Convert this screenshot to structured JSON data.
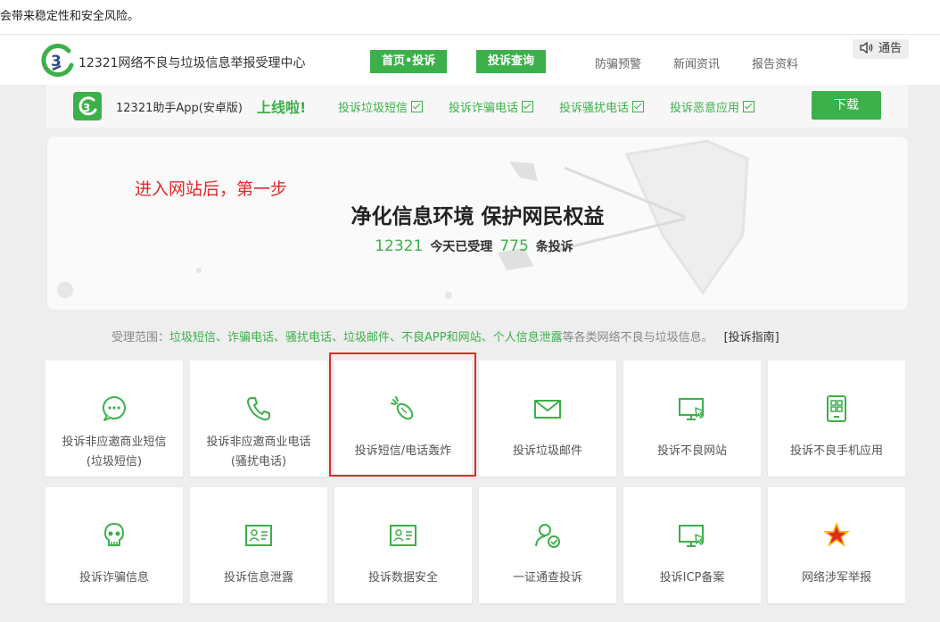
{
  "warning_text": "会带来稳定性和安全风险。",
  "header": {
    "site_title": "12321网络不良与垃圾信息举报受理中心",
    "nav_buttons": [
      "首页•投诉",
      "投诉查询"
    ],
    "nav_links": [
      "防骗预警",
      "新闻资讯",
      "报告资料"
    ],
    "notice": "通告",
    "notice_icon": "speaker-icon"
  },
  "app_bar": {
    "app_name": "12321助手App(安卓版)",
    "online": "上线啦!",
    "features": [
      "投诉垃圾短信",
      "投诉诈骗电话",
      "投诉骚扰电话",
      "投诉恶意应用"
    ],
    "download": "下载"
  },
  "hero": {
    "note": "进入网站后，第一步",
    "slogan": "净化信息环境 保护网民权益",
    "count_a": "12321",
    "text_a": "今天已受理",
    "count_b": "775",
    "text_b": "条投诉"
  },
  "scope": {
    "prefix": "受理范围：",
    "items": "垃圾短信、诈骗电话、骚扰电话、垃圾邮件、不良APP和网站、个人信息泄露",
    "suffix": "等各类网络不良与垃圾信息。",
    "guide": "[投诉指南]"
  },
  "colors": {
    "brand_green": "#3cb04a",
    "highlight_red": "#e02a2a"
  },
  "tiles_row1": [
    {
      "line1": "投诉非应邀商业短信",
      "line2": "(垃圾短信)",
      "icon": "message-icon"
    },
    {
      "line1": "投诉非应邀商业电话",
      "line2": "(骚扰电话)",
      "icon": "phone-icon"
    },
    {
      "line1": "投诉短信/电话轰炸",
      "icon": "bomb-icon"
    },
    {
      "line1": "投诉垃圾邮件",
      "icon": "mail-icon"
    },
    {
      "line1": "投诉不良网站",
      "icon": "monitor-icon"
    },
    {
      "line1": "投诉不良手机应用",
      "icon": "app-icon"
    }
  ],
  "tiles_row2": [
    {
      "line1": "投诉诈骗信息",
      "icon": "skull-icon"
    },
    {
      "line1": "投诉信息泄露",
      "icon": "id-card-icon"
    },
    {
      "line1": "投诉数据安全",
      "icon": "id-card-icon"
    },
    {
      "line1": "一证通查投诉",
      "icon": "user-check-icon"
    },
    {
      "line1": "投诉ICP备案",
      "icon": "monitor-icon"
    },
    {
      "line1": "网络涉军举报",
      "icon": "army-star-icon"
    }
  ]
}
